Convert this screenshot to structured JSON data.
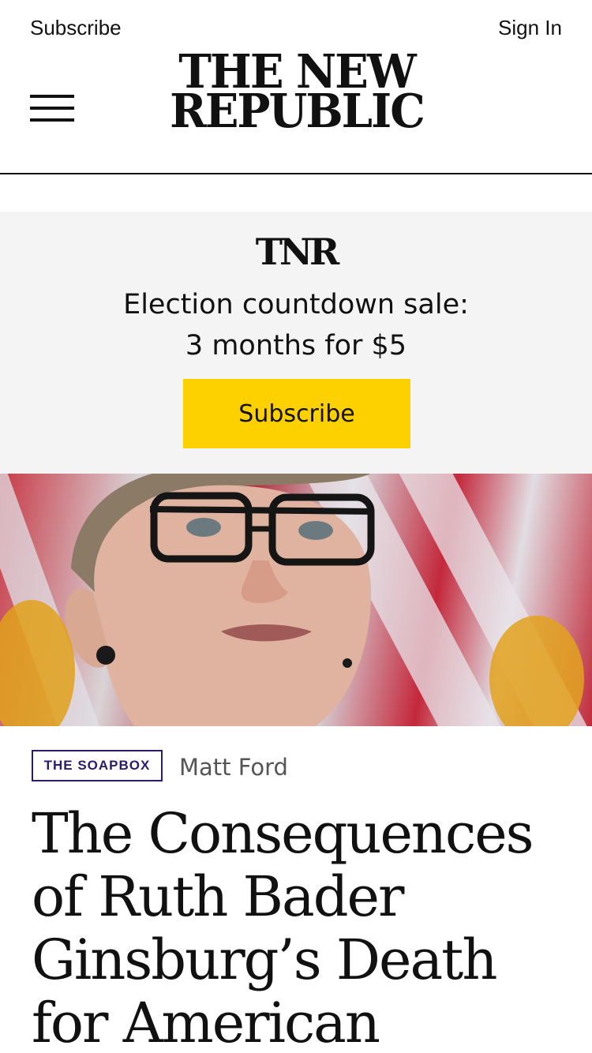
{
  "header": {
    "subscribe_label": "Subscribe",
    "sign_in_label": "Sign In",
    "logo_line1": "THE NEW",
    "logo_line2": "REPUBLIC"
  },
  "promo": {
    "logo": "TNR",
    "line1": "Election countdown sale:",
    "line2": "3 months for $5",
    "button_label": "Subscribe",
    "button_color": "#fdd000"
  },
  "article": {
    "section_tag": "THE SOAPBOX",
    "author": "Matt Ford",
    "headline": "The Consequences of Ruth Bader Ginsburg’s Death for American",
    "tag_color": "#2e1a6b"
  }
}
